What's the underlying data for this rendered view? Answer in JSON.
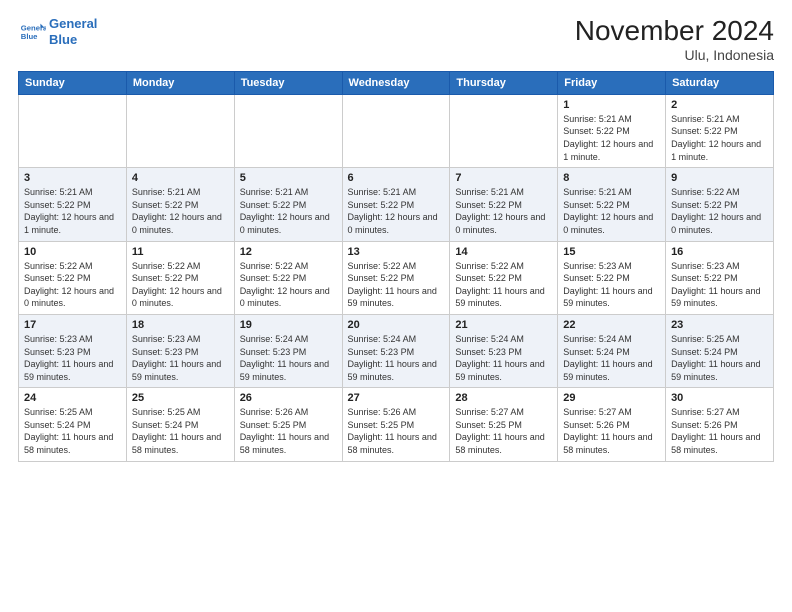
{
  "header": {
    "month": "November 2024",
    "location": "Ulu, Indonesia",
    "logo_line1": "General",
    "logo_line2": "Blue"
  },
  "weekdays": [
    "Sunday",
    "Monday",
    "Tuesday",
    "Wednesday",
    "Thursday",
    "Friday",
    "Saturday"
  ],
  "weeks": [
    [
      {
        "day": "",
        "info": ""
      },
      {
        "day": "",
        "info": ""
      },
      {
        "day": "",
        "info": ""
      },
      {
        "day": "",
        "info": ""
      },
      {
        "day": "",
        "info": ""
      },
      {
        "day": "1",
        "info": "Sunrise: 5:21 AM\nSunset: 5:22 PM\nDaylight: 12 hours and 1 minute."
      },
      {
        "day": "2",
        "info": "Sunrise: 5:21 AM\nSunset: 5:22 PM\nDaylight: 12 hours and 1 minute."
      }
    ],
    [
      {
        "day": "3",
        "info": "Sunrise: 5:21 AM\nSunset: 5:22 PM\nDaylight: 12 hours and 1 minute."
      },
      {
        "day": "4",
        "info": "Sunrise: 5:21 AM\nSunset: 5:22 PM\nDaylight: 12 hours and 0 minutes."
      },
      {
        "day": "5",
        "info": "Sunrise: 5:21 AM\nSunset: 5:22 PM\nDaylight: 12 hours and 0 minutes."
      },
      {
        "day": "6",
        "info": "Sunrise: 5:21 AM\nSunset: 5:22 PM\nDaylight: 12 hours and 0 minutes."
      },
      {
        "day": "7",
        "info": "Sunrise: 5:21 AM\nSunset: 5:22 PM\nDaylight: 12 hours and 0 minutes."
      },
      {
        "day": "8",
        "info": "Sunrise: 5:21 AM\nSunset: 5:22 PM\nDaylight: 12 hours and 0 minutes."
      },
      {
        "day": "9",
        "info": "Sunrise: 5:22 AM\nSunset: 5:22 PM\nDaylight: 12 hours and 0 minutes."
      }
    ],
    [
      {
        "day": "10",
        "info": "Sunrise: 5:22 AM\nSunset: 5:22 PM\nDaylight: 12 hours and 0 minutes."
      },
      {
        "day": "11",
        "info": "Sunrise: 5:22 AM\nSunset: 5:22 PM\nDaylight: 12 hours and 0 minutes."
      },
      {
        "day": "12",
        "info": "Sunrise: 5:22 AM\nSunset: 5:22 PM\nDaylight: 12 hours and 0 minutes."
      },
      {
        "day": "13",
        "info": "Sunrise: 5:22 AM\nSunset: 5:22 PM\nDaylight: 11 hours and 59 minutes."
      },
      {
        "day": "14",
        "info": "Sunrise: 5:22 AM\nSunset: 5:22 PM\nDaylight: 11 hours and 59 minutes."
      },
      {
        "day": "15",
        "info": "Sunrise: 5:23 AM\nSunset: 5:22 PM\nDaylight: 11 hours and 59 minutes."
      },
      {
        "day": "16",
        "info": "Sunrise: 5:23 AM\nSunset: 5:22 PM\nDaylight: 11 hours and 59 minutes."
      }
    ],
    [
      {
        "day": "17",
        "info": "Sunrise: 5:23 AM\nSunset: 5:23 PM\nDaylight: 11 hours and 59 minutes."
      },
      {
        "day": "18",
        "info": "Sunrise: 5:23 AM\nSunset: 5:23 PM\nDaylight: 11 hours and 59 minutes."
      },
      {
        "day": "19",
        "info": "Sunrise: 5:24 AM\nSunset: 5:23 PM\nDaylight: 11 hours and 59 minutes."
      },
      {
        "day": "20",
        "info": "Sunrise: 5:24 AM\nSunset: 5:23 PM\nDaylight: 11 hours and 59 minutes."
      },
      {
        "day": "21",
        "info": "Sunrise: 5:24 AM\nSunset: 5:23 PM\nDaylight: 11 hours and 59 minutes."
      },
      {
        "day": "22",
        "info": "Sunrise: 5:24 AM\nSunset: 5:24 PM\nDaylight: 11 hours and 59 minutes."
      },
      {
        "day": "23",
        "info": "Sunrise: 5:25 AM\nSunset: 5:24 PM\nDaylight: 11 hours and 59 minutes."
      }
    ],
    [
      {
        "day": "24",
        "info": "Sunrise: 5:25 AM\nSunset: 5:24 PM\nDaylight: 11 hours and 58 minutes."
      },
      {
        "day": "25",
        "info": "Sunrise: 5:25 AM\nSunset: 5:24 PM\nDaylight: 11 hours and 58 minutes."
      },
      {
        "day": "26",
        "info": "Sunrise: 5:26 AM\nSunset: 5:25 PM\nDaylight: 11 hours and 58 minutes."
      },
      {
        "day": "27",
        "info": "Sunrise: 5:26 AM\nSunset: 5:25 PM\nDaylight: 11 hours and 58 minutes."
      },
      {
        "day": "28",
        "info": "Sunrise: 5:27 AM\nSunset: 5:25 PM\nDaylight: 11 hours and 58 minutes."
      },
      {
        "day": "29",
        "info": "Sunrise: 5:27 AM\nSunset: 5:26 PM\nDaylight: 11 hours and 58 minutes."
      },
      {
        "day": "30",
        "info": "Sunrise: 5:27 AM\nSunset: 5:26 PM\nDaylight: 11 hours and 58 minutes."
      }
    ]
  ]
}
